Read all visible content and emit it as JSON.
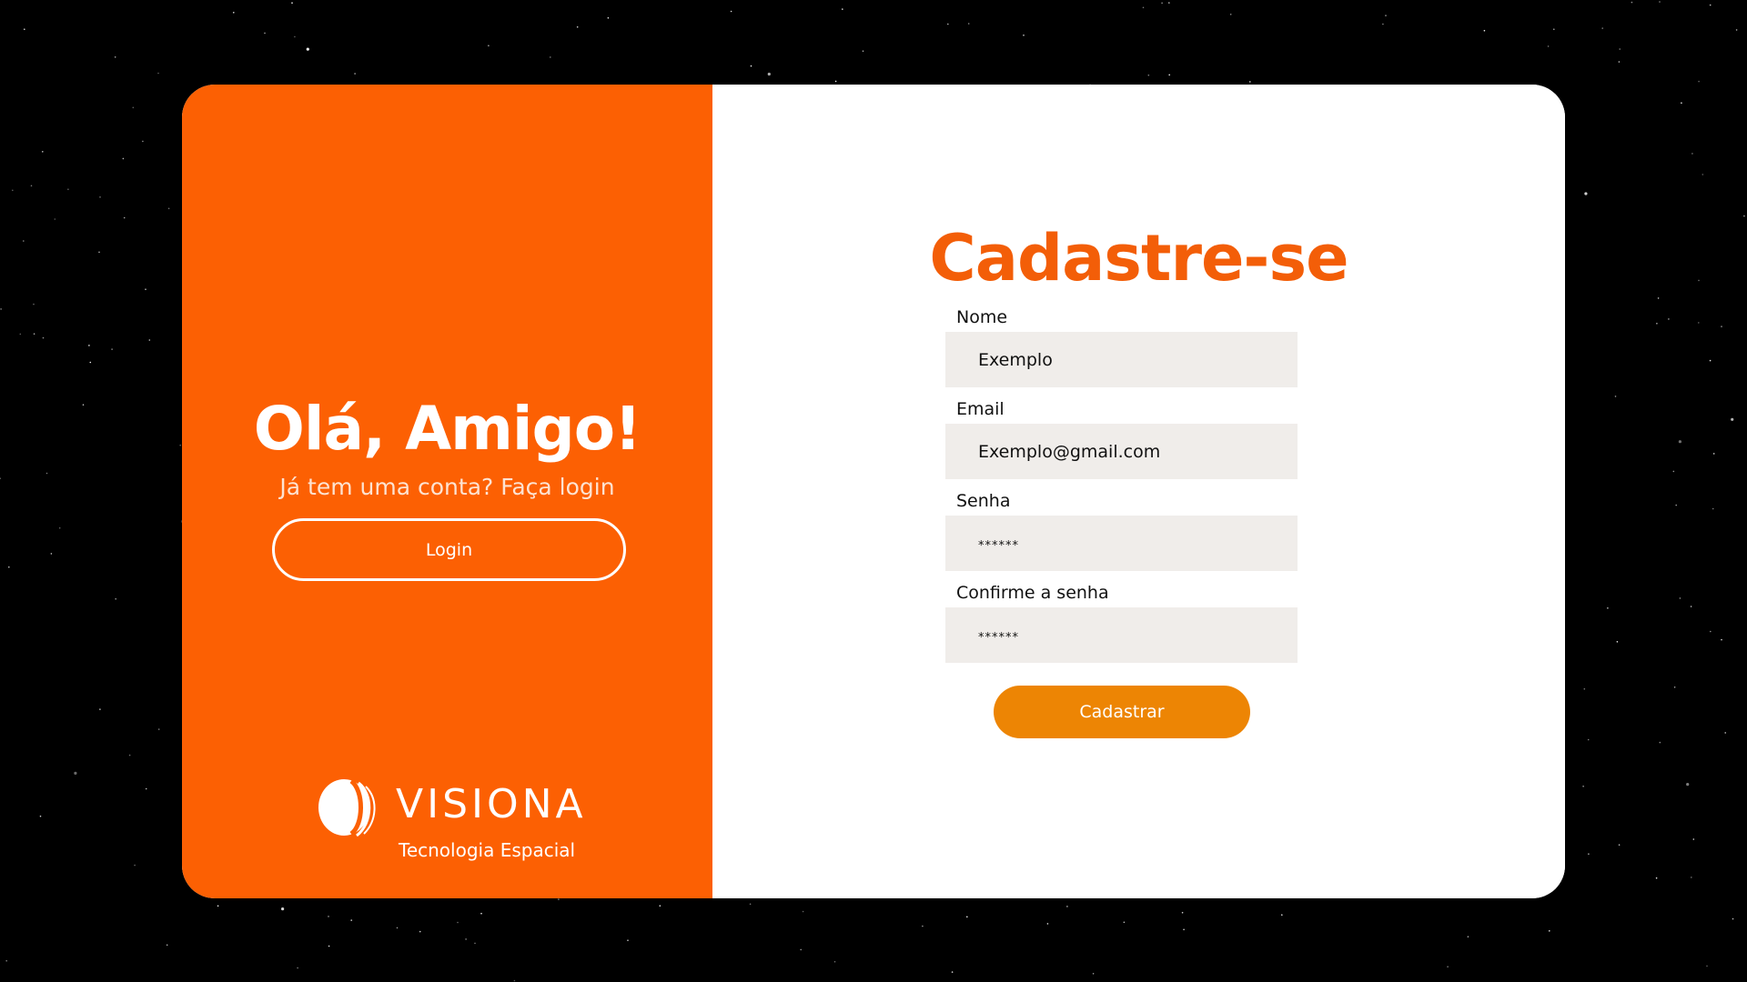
{
  "colors": {
    "background": "#000000",
    "brand_orange": "#fc6003",
    "title_orange": "#f35e08",
    "button_orange": "#ed8504",
    "input_bg": "#f0edea"
  },
  "left_panel": {
    "greeting": "Olá, Amigo!",
    "subtext": "Já tem uma conta? Faça login",
    "login_button": "Login",
    "logo": {
      "icon": "visiona-logo-icon",
      "name": "VISIONA",
      "tagline": "Tecnologia Espacial"
    }
  },
  "form": {
    "title": "Cadastre-se",
    "fields": [
      {
        "label": "Nome",
        "placeholder": "Exemplo"
      },
      {
        "label": "Email",
        "placeholder": "Exemplo@gmail.com"
      },
      {
        "label": "Senha",
        "placeholder": "******"
      },
      {
        "label": "Confirme a senha",
        "placeholder": "******"
      }
    ],
    "submit_button": "Cadastrar"
  }
}
